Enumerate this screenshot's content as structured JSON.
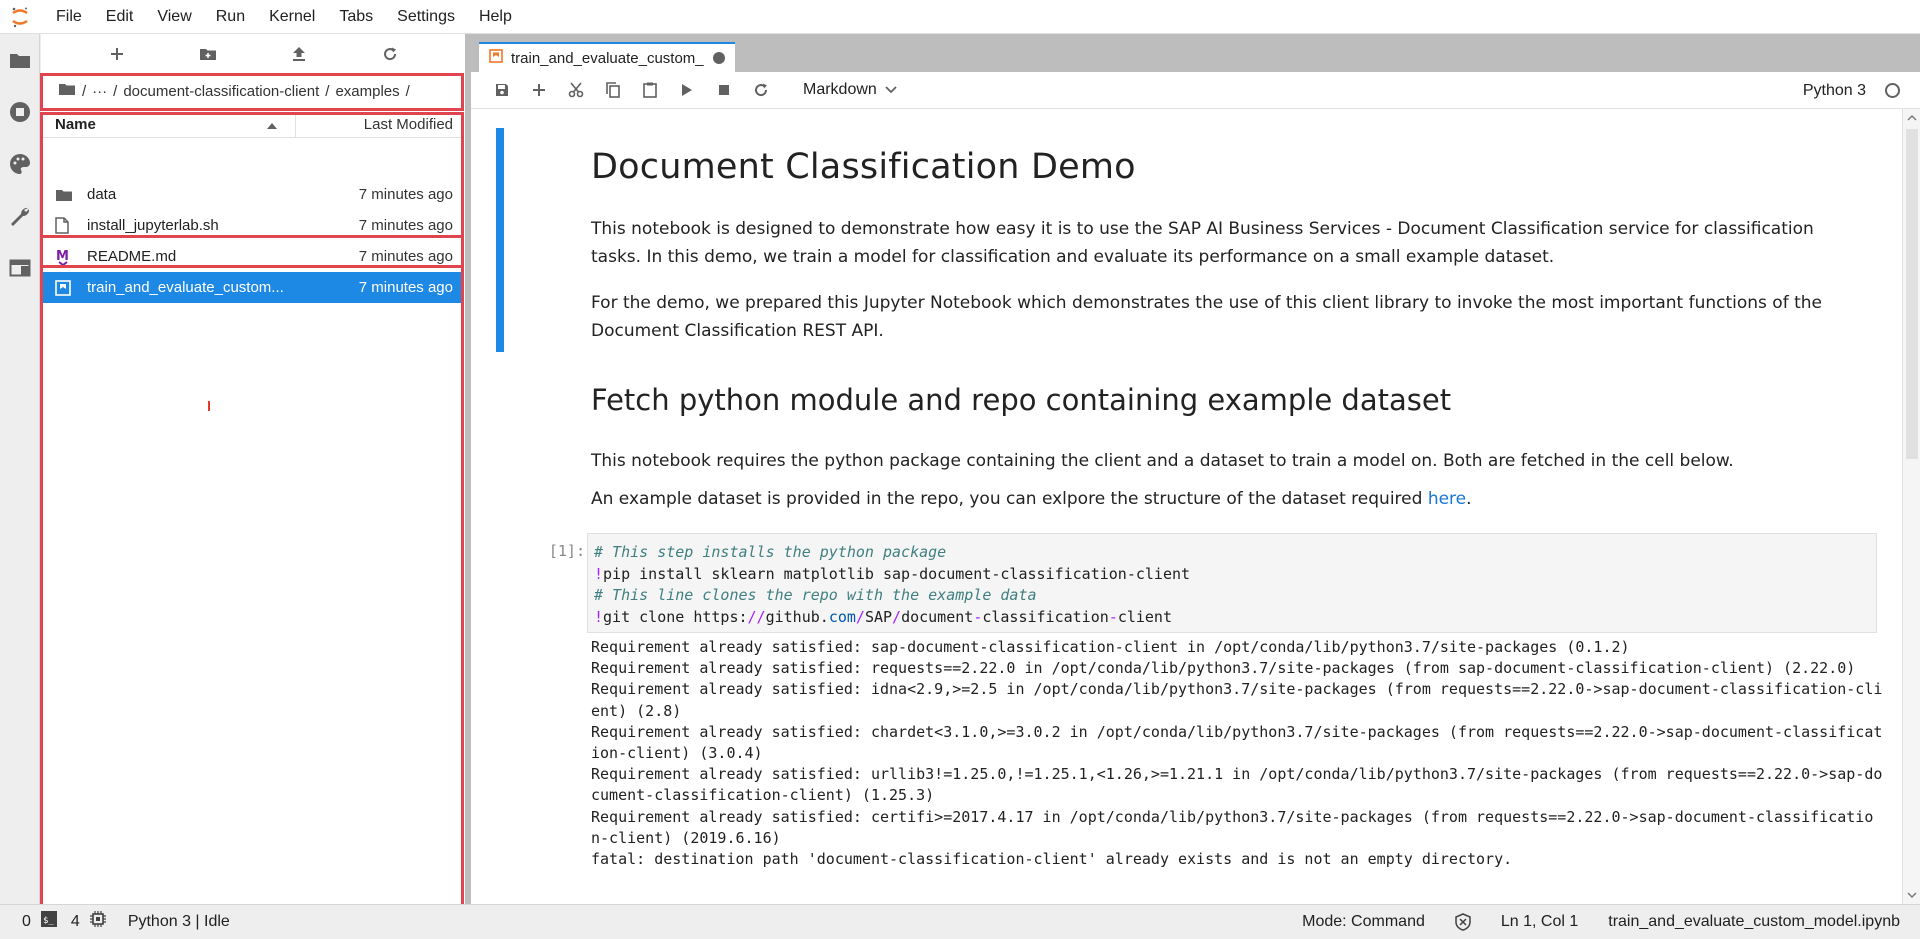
{
  "menubar": {
    "items": [
      "File",
      "Edit",
      "View",
      "Run",
      "Kernel",
      "Tabs",
      "Settings",
      "Help"
    ]
  },
  "activitybar": {
    "icons": [
      "folder-icon",
      "running-icon",
      "palette-icon",
      "wrench-icon",
      "tabs-icon"
    ]
  },
  "filebrowser": {
    "toolbar": [
      "new-launcher-icon",
      "new-folder-icon",
      "upload-icon",
      "refresh-icon"
    ],
    "breadcrumb": {
      "ellipsis": "···",
      "sep": "/",
      "folder": "document-classification-client",
      "subfolder": "examples"
    },
    "columns": {
      "name": "Name",
      "modified": "Last Modified"
    },
    "files": [
      {
        "name": "data",
        "modified": "7 minutes ago",
        "icon": "folder-icon"
      },
      {
        "name": "install_jupyterlab.sh",
        "modified": "7 minutes ago",
        "icon": "file-icon"
      },
      {
        "name": "README.md",
        "modified": "7 minutes ago",
        "icon": "markdown-icon"
      },
      {
        "name": "train_and_evaluate_custom...",
        "modified": "7 minutes ago",
        "icon": "notebook-icon",
        "selected": true
      }
    ]
  },
  "tab": {
    "label": "train_and_evaluate_custom_"
  },
  "notebook_toolbar": {
    "cell_type": "Markdown",
    "kernel": "Python 3"
  },
  "notebook": {
    "title": "Document Classification Demo",
    "p1": "This notebook is designed to demonstrate how easy it is to use the SAP AI Business Services - Document Classification service for classification tasks. In this demo, we train a model for classification and evaluate its performance on a small example dataset.",
    "p2": "For the demo, we prepared this Jupyter Notebook which demonstrates the use of this client library to invoke the most important functions of the Document Classification REST API.",
    "h2": "Fetch python module and repo containing example dataset",
    "p3": "This notebook requires the python package containing the client and a dataset to train a model on. Both are fetched in the cell below.",
    "p4_prefix": "An example dataset is provided in the repo, you can exlpore the structure of the dataset required ",
    "p4_link": "here",
    "p4_suffix": ".",
    "prompt": "[1]:",
    "code": {
      "c1": "# This step installs the python package",
      "l2_bang": "!",
      "l2_rest": "pip install sklearn matplotlib sap-document-classification-client",
      "c3": "# This line clones the repo with the example data",
      "l4_bang": "!",
      "l4_a": "git clone https:",
      "l4_b": "//",
      "l4_c": "github.",
      "l4_d": "com",
      "l4_e": "/",
      "l4_f": "SAP",
      "l4_g": "/",
      "l4_h": "document",
      "l4_i": "-",
      "l4_j": "classification",
      "l4_k": "-",
      "l4_l": "client"
    },
    "output": [
      "Requirement already satisfied: sap-document-classification-client in /opt/conda/lib/python3.7/site-packages (0.1.2)",
      "Requirement already satisfied: requests==2.22.0 in /opt/conda/lib/python3.7/site-packages (from sap-document-classification-client) (2.22.0)",
      "Requirement already satisfied: idna<2.9,>=2.5 in /opt/conda/lib/python3.7/site-packages (from requests==2.22.0->sap-document-classification-cli",
      "ent) (2.8)",
      "Requirement already satisfied: chardet<3.1.0,>=3.0.2 in /opt/conda/lib/python3.7/site-packages (from requests==2.22.0->sap-document-classificat",
      "ion-client) (3.0.4)",
      "Requirement already satisfied: urllib3!=1.25.0,!=1.25.1,<1.26,>=1.21.1 in /opt/conda/lib/python3.7/site-packages (from requests==2.22.0->sap-do",
      "cument-classification-client) (1.25.3)",
      "Requirement already satisfied: certifi>=2017.4.17 in /opt/conda/lib/python3.7/site-packages (from requests==2.22.0->sap-document-classificatio",
      "n-client) (2019.6.16)",
      "fatal: destination path 'document-classification-client' already exists and is not an empty directory."
    ]
  },
  "statusbar": {
    "terminals": "0",
    "kernels": "4",
    "kernel_status": "Python 3 | Idle",
    "mode": "Mode: Command",
    "position": "Ln 1, Col 1",
    "filename": "train_and_evaluate_custom_model.ipynb"
  },
  "colors": {
    "accent": "#1e88e5",
    "highlight_box": "#e0444e",
    "jupyter_orange": "#f37726"
  }
}
